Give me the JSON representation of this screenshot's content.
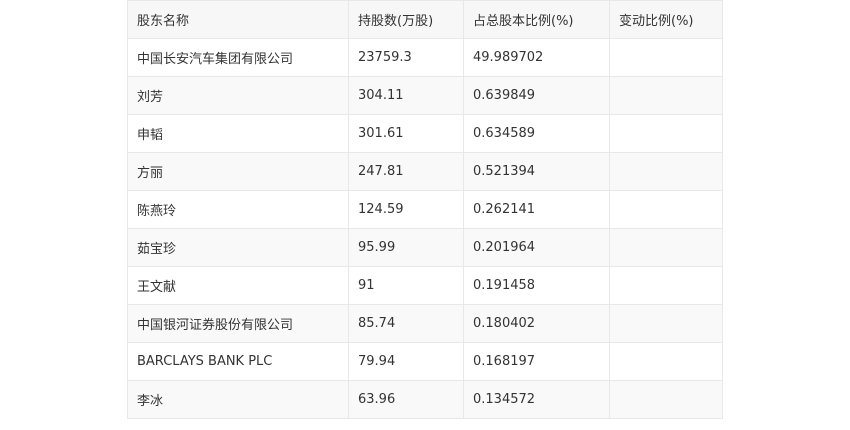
{
  "table": {
    "headers": [
      "股东名称",
      "持股数(万股)",
      "占总股本比例(%)",
      "变动比例(%)"
    ],
    "rows": [
      [
        "中国长安汽车集团有限公司",
        "23759.3",
        "49.989702",
        ""
      ],
      [
        "刘芳",
        "304.11",
        "0.639849",
        ""
      ],
      [
        "申韬",
        "301.61",
        "0.634589",
        ""
      ],
      [
        "方丽",
        "247.81",
        "0.521394",
        ""
      ],
      [
        "陈燕玲",
        "124.59",
        "0.262141",
        ""
      ],
      [
        "茹宝珍",
        "95.99",
        "0.201964",
        ""
      ],
      [
        "王文献",
        "91",
        "0.191458",
        ""
      ],
      [
        "中国银河证券股份有限公司",
        "85.74",
        "0.180402",
        ""
      ],
      [
        "BARCLAYS BANK PLC",
        "79.94",
        "0.168197",
        ""
      ],
      [
        "李冰",
        "63.96",
        "0.134572",
        ""
      ]
    ]
  }
}
